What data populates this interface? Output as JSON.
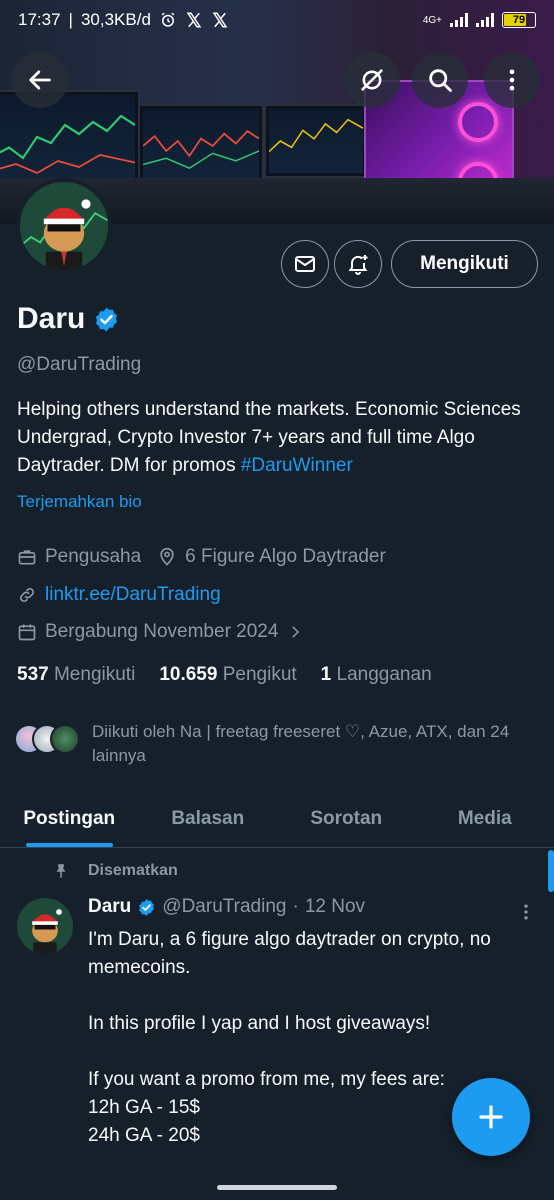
{
  "status": {
    "time": "17:37",
    "net_speed": "30,3KB/d",
    "battery": "79",
    "net_type": "4G+",
    "icons": [
      "alarm-icon",
      "x-logo-icon",
      "x-logo-icon"
    ]
  },
  "header": {
    "back_icon": "arrow-left-icon",
    "grok_icon": "grok-icon",
    "search_icon": "search-icon",
    "more_icon": "more-vertical-icon"
  },
  "actions": {
    "message_icon": "mail-icon",
    "notify_icon": "bell-plus-icon",
    "follow_label": "Mengikuti"
  },
  "profile": {
    "name": "Daru",
    "handle": "@DaruTrading",
    "bio_text": "Helping others understand the markets. Economic Sciences Undergrad, Crypto Investor 7+ years and full time Algo Daytrader. DM for promos ",
    "bio_hashtag": "#DaruWinner",
    "translate": "Terjemahkan bio",
    "category": "Pengusaha",
    "location": "6 Figure Algo Daytrader",
    "website": "linktr.ee/DaruTrading",
    "joined": "Bergabung November 2024"
  },
  "stats": {
    "following_count": "537",
    "following_label": "Mengikuti",
    "followers_count": "10.659",
    "followers_label": "Pengikut",
    "subs_count": "1",
    "subs_label": "Langganan"
  },
  "followed_by": "Diikuti oleh Na | freetag freeseret ♡, Azue, ATX, dan 24 lainnya",
  "tabs": [
    {
      "label": "Postingan",
      "active": true
    },
    {
      "label": "Balasan",
      "active": false
    },
    {
      "label": "Sorotan",
      "active": false
    },
    {
      "label": "Media",
      "active": false
    }
  ],
  "post": {
    "pinned_label": "Disematkan",
    "author": "Daru",
    "handle": "@DaruTrading",
    "separator": "·",
    "date": "12 Nov",
    "body": "I'm Daru, a 6 figure algo daytrader on crypto, no memecoins.\n\nIn this profile I yap and I host giveaways!\n\nIf you want a promo from me, my fees are:\n12h GA - 15$\n24h GA - 20$"
  },
  "colors": {
    "background": "#15202b",
    "accent": "#1d9bf0",
    "muted": "#8b98a5"
  }
}
